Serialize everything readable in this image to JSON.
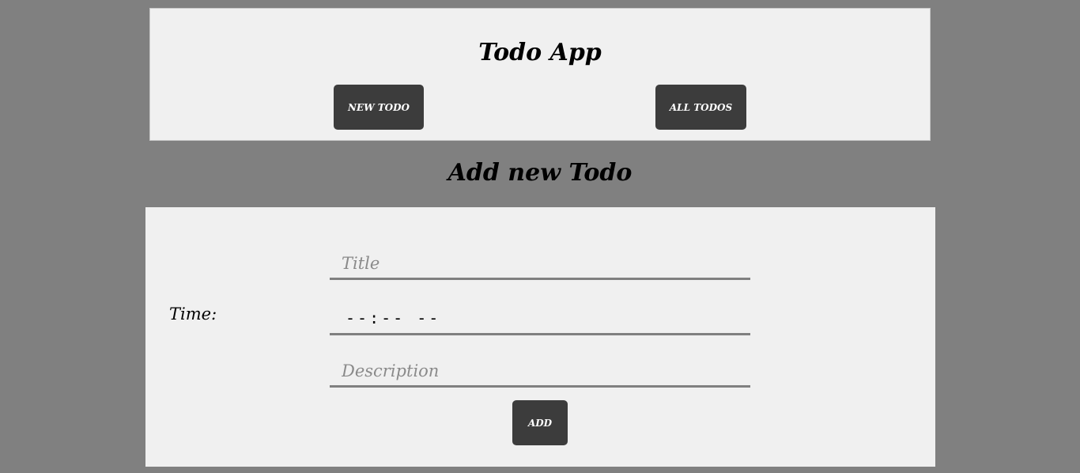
{
  "header": {
    "app_title": "Todo App",
    "nav": {
      "new_todo_label": "NEW TODO",
      "all_todos_label": "ALL TODOS"
    }
  },
  "main": {
    "section_title": "Add new Todo",
    "form": {
      "title_placeholder": "Title",
      "title_value": "",
      "time_label": "Time:",
      "time_display": "--:-- --",
      "description_placeholder": "Description",
      "description_value": "",
      "add_label": "ADD"
    }
  },
  "colors": {
    "page_background": "#808080",
    "panel_background": "#f0f0f0",
    "button_background": "#3c3c3c",
    "button_text": "#ffffff",
    "field_underline": "#808080"
  }
}
